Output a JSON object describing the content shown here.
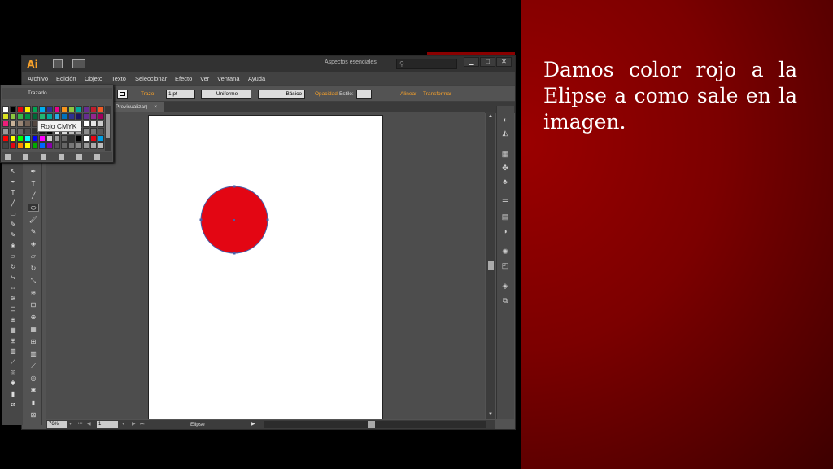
{
  "slide": {
    "text": "Damos color rojo a la Elipse a como sale en la imagen.",
    "background_color": "#8b0000"
  },
  "app": {
    "logo": "Ai",
    "workspace": "Aspectos esenciales",
    "workspace_arrow": "▾",
    "search_icon": "⚲",
    "win_minimize": "▁",
    "win_maximize": "□",
    "win_close": "✕"
  },
  "menu": [
    "Archivo",
    "Edición",
    "Objeto",
    "Texto",
    "Seleccionar",
    "Efecto",
    "Ver",
    "Ventana",
    "Ayuda"
  ],
  "control_bar": {
    "object_type": "Trazado",
    "fill_color": "#e30613",
    "stroke_label": "Trazo:",
    "stroke_weight": "1 pt",
    "profile": "Uniforme",
    "brush": "Básico",
    "opacity_label": "Opacidad",
    "style_label": "Estilo:",
    "align_label": "Alinear",
    "transform_label": "Transformar"
  },
  "document": {
    "tab_label": "Previsualizar)",
    "tab_close": "×",
    "ellipse_color": "#e30613",
    "ellipse_stroke": "#4a5fa8"
  },
  "swatches": {
    "tooltip": "Rojo CMYK",
    "selected": "Rojo CMYK"
  },
  "status": {
    "zoom": "76%",
    "page": "1",
    "object": "Elipse"
  },
  "icons": {
    "ellipse": "ellipse-icon",
    "pen": "pen-icon",
    "type": "type-icon",
    "line": "line-icon",
    "brush": "brush-icon"
  }
}
